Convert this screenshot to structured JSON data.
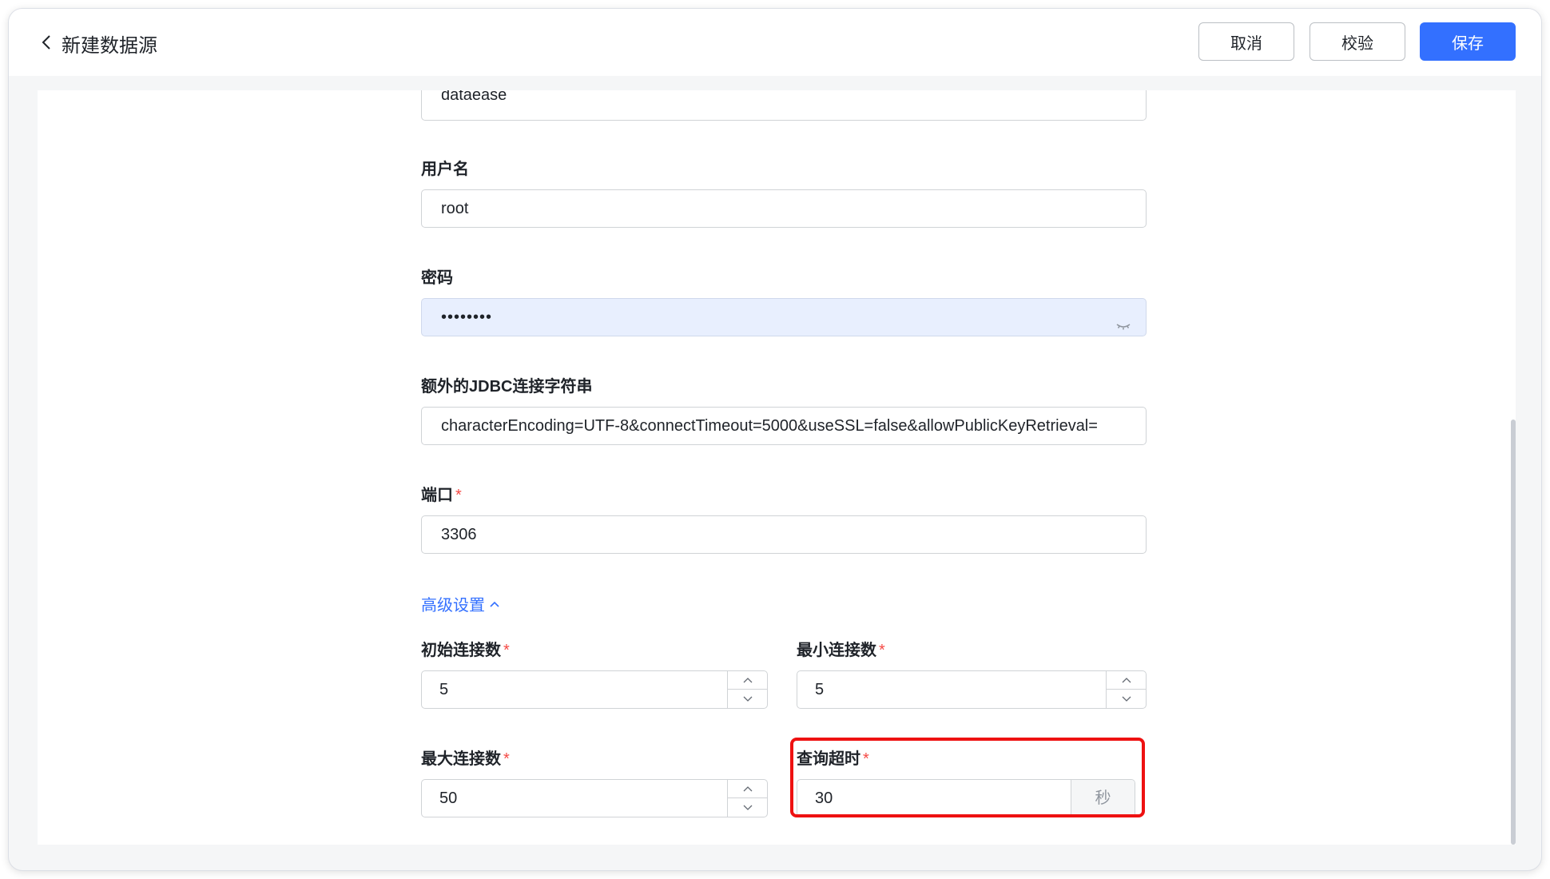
{
  "header": {
    "title": "新建数据源",
    "cancel_label": "取消",
    "validate_label": "校验",
    "save_label": "保存"
  },
  "form": {
    "database_partial_value": "dataease",
    "username": {
      "label": "用户名",
      "value": "root"
    },
    "password": {
      "label": "密码",
      "value": "••••••••"
    },
    "jdbc": {
      "label": "额外的JDBC连接字符串",
      "value": "characterEncoding=UTF-8&connectTimeout=5000&useSSL=false&allowPublicKeyRetrieval="
    },
    "port": {
      "label": "端口",
      "required_mark": "*",
      "value": "3306"
    },
    "advanced_toggle": "高级设置",
    "initial_conn": {
      "label": "初始连接数",
      "required_mark": "*",
      "value": "5"
    },
    "min_conn": {
      "label": "最小连接数",
      "required_mark": "*",
      "value": "5"
    },
    "max_conn": {
      "label": "最大连接数",
      "required_mark": "*",
      "value": "50"
    },
    "query_timeout": {
      "label": "查询超时",
      "required_mark": "*",
      "value": "30",
      "unit": "秒"
    }
  },
  "colors": {
    "primary": "#3370ff",
    "required": "#f54a45",
    "highlight": "#ee1111"
  }
}
